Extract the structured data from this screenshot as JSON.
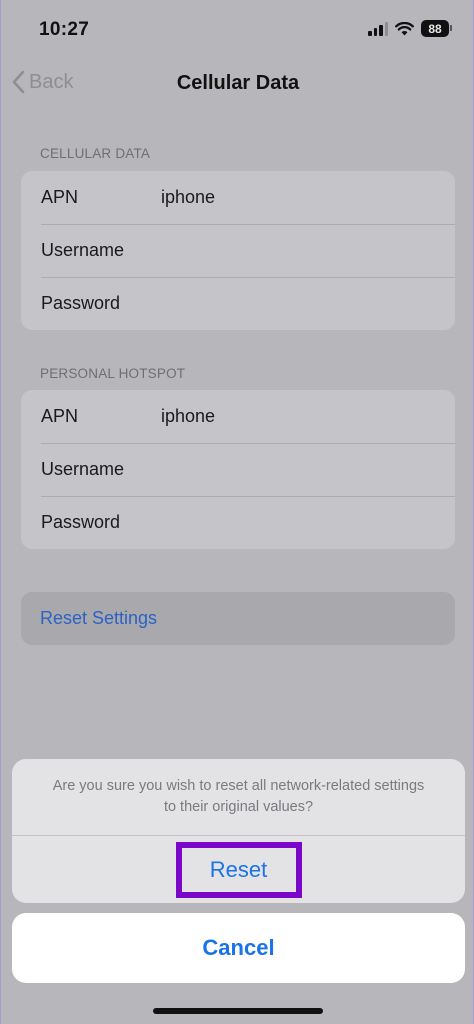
{
  "status_bar": {
    "time": "10:27",
    "battery_level": "88",
    "icons": [
      "signal-icon",
      "wifi-icon",
      "battery-icon"
    ]
  },
  "nav": {
    "back_label": "Back",
    "title": "Cellular Data"
  },
  "cellular_data": {
    "header": "CELLULAR DATA",
    "rows": [
      {
        "label": "APN",
        "value": "iphone"
      },
      {
        "label": "Username",
        "value": ""
      },
      {
        "label": "Password",
        "value": ""
      }
    ]
  },
  "personal_hotspot": {
    "header": "PERSONAL HOTSPOT",
    "rows": [
      {
        "label": "APN",
        "value": "iphone"
      },
      {
        "label": "Username",
        "value": ""
      },
      {
        "label": "Password",
        "value": ""
      }
    ]
  },
  "reset_settings_label": "Reset Settings",
  "action_sheet": {
    "message": "Are you sure you wish to reset all network-related settings to their original values?",
    "reset_label": "Reset",
    "cancel_label": "Cancel"
  },
  "colors": {
    "accent_blue": "#1a73e8",
    "highlight_purple": "#7b08c9"
  }
}
